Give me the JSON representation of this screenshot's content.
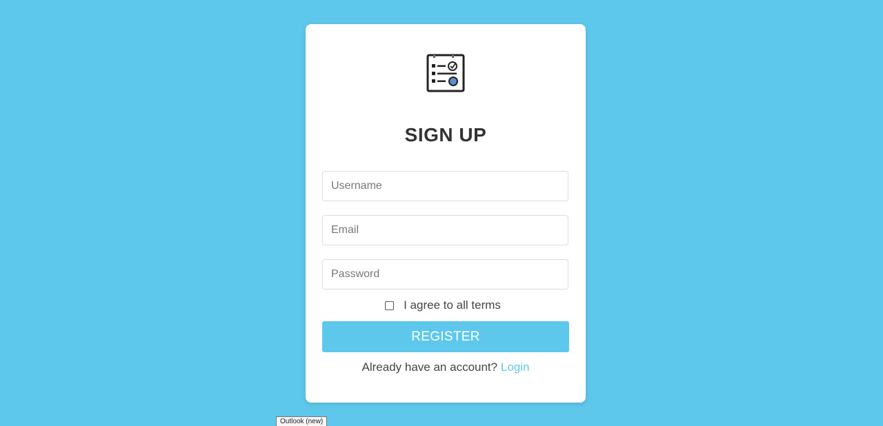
{
  "signup": {
    "title": "SIGN UP",
    "username_placeholder": "Username",
    "email_placeholder": "Email",
    "password_placeholder": "Password",
    "terms_label": "I agree to all terms",
    "terms_checked": false,
    "register_label": "REGISTER",
    "account_prompt": "Already have an account?",
    "login_label": "Login"
  },
  "icons": {
    "logo": "checklist-icon",
    "checkbox": "checkbox-unchecked"
  },
  "colors": {
    "background": "#5ec8ec",
    "card": "#ffffff",
    "accent": "#5ec8ec",
    "title_text": "#333333"
  },
  "tooltip": {
    "text": "Outlook (new)"
  }
}
